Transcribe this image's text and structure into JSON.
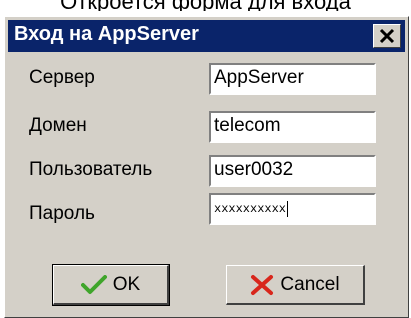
{
  "dialog": {
    "title": "Вход на AppServer",
    "fields": [
      {
        "label": "Сервер",
        "value": "AppServer"
      },
      {
        "label": "Домен",
        "value": "telecom"
      },
      {
        "label": "Пользователь",
        "value": "user0032"
      },
      {
        "label": "Пароль",
        "value": "xxxxxxxxxx"
      }
    ],
    "ok_label": "OK",
    "cancel_label": "Cancel"
  },
  "icons": {
    "close": "close-icon",
    "ok": "checkmark-icon",
    "cancel": "x-icon"
  },
  "colors": {
    "titlebar": "#0a246a",
    "dialog_bg": "#d4d0c8",
    "check_green": "#3fa52b",
    "cancel_red": "#d8261c"
  }
}
